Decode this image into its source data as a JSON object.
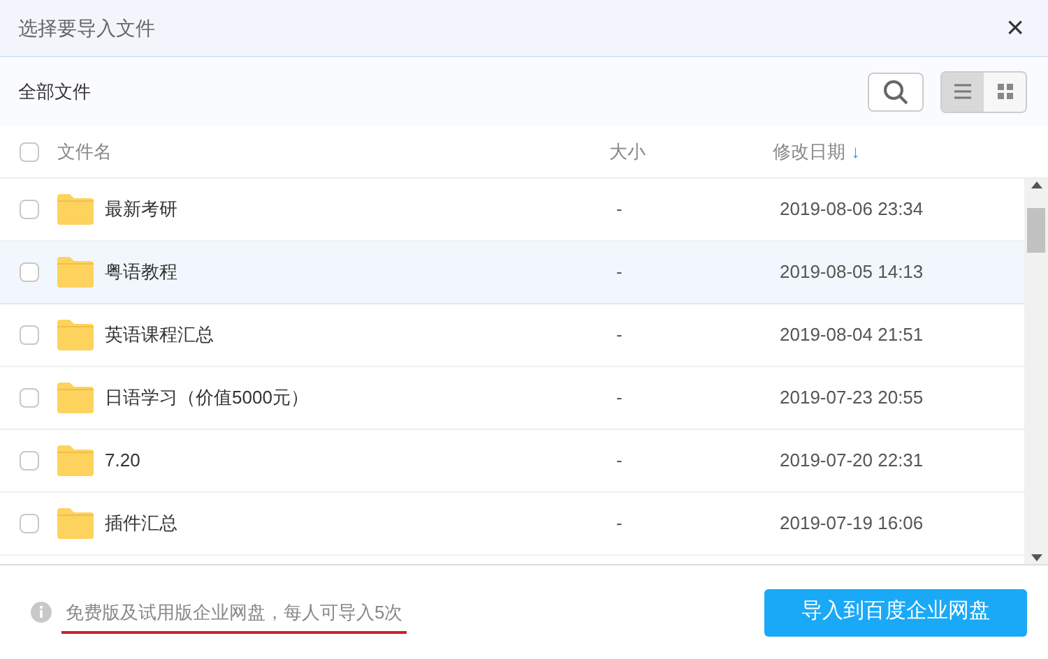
{
  "window": {
    "title": "选择要导入文件",
    "close": "×"
  },
  "toolbar": {
    "breadcrumb": "全部文件",
    "views": [
      {
        "kind": "list",
        "selected": true
      },
      {
        "kind": "grid",
        "selected": false
      }
    ]
  },
  "table": {
    "columns": [
      "文件名",
      "大小",
      "修改日期"
    ],
    "sort_arrow": "↓",
    "all_checked": false,
    "rows": [
      {
        "name": "最新考研",
        "size": "-",
        "modified": "2019-08-06 23:34",
        "checked": false,
        "selected": false
      },
      {
        "name": "粤语教程",
        "size": "-",
        "modified": "2019-08-05 14:13",
        "checked": false,
        "selected": true
      },
      {
        "name": "英语课程汇总",
        "size": "-",
        "modified": "2019-08-04 21:51",
        "checked": false,
        "selected": false
      },
      {
        "name": "日语学习（价值5000元）",
        "size": "-",
        "modified": "2019-07-23 20:55",
        "checked": false,
        "selected": false
      },
      {
        "name": "7.20",
        "size": "-",
        "modified": "2019-07-20 22:31",
        "checked": false,
        "selected": false
      },
      {
        "name": "插件汇总",
        "size": "-",
        "modified": "2019-07-19 16:06",
        "checked": false,
        "selected": false
      }
    ]
  },
  "footer": {
    "notice": "免费版及试用版企业网盘，每人可导入5次",
    "button": "导入到百度企业网盘"
  }
}
